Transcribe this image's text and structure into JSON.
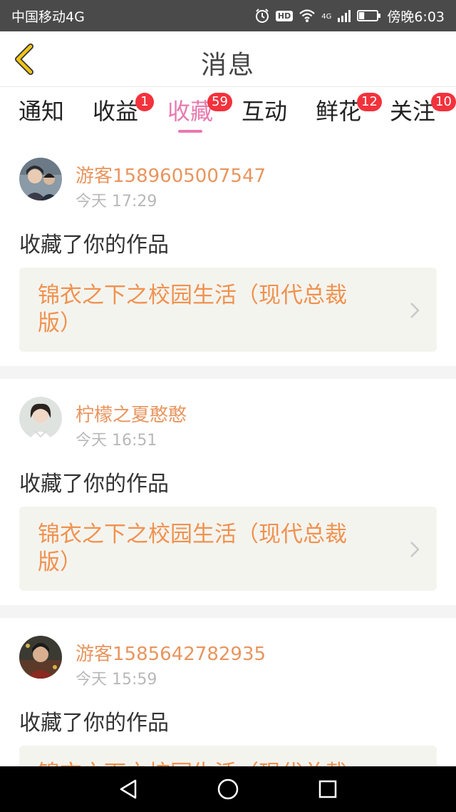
{
  "status_bar": {
    "carrier": "中国移动4G",
    "network_type": "4G",
    "time": "傍晚6:03",
    "icons": [
      "alarm-icon",
      "hd-icon",
      "wifi-icon",
      "signal-icon",
      "battery-icon"
    ],
    "hd_label": "HD",
    "battery_level": 0.3
  },
  "header": {
    "title": "消息",
    "back_icon": "chevron-left-icon"
  },
  "tabs": [
    {
      "label": "通知",
      "badge": "",
      "active": false
    },
    {
      "label": "收益",
      "badge": "1",
      "active": false
    },
    {
      "label": "收藏",
      "badge": "59",
      "active": true
    },
    {
      "label": "互动",
      "badge": "",
      "active": false
    },
    {
      "label": "鲜花",
      "badge": "12",
      "active": false
    },
    {
      "label": "关注",
      "badge": "10",
      "active": false
    }
  ],
  "feed": [
    {
      "username": "游客1589605007547",
      "time": "今天 17:29",
      "action": "收藏了你的作品",
      "work_title": "锦衣之下之校园生活（现代总裁版）"
    },
    {
      "username": "柠檬之夏憨憨",
      "time": "今天 16:51",
      "action": "收藏了你的作品",
      "work_title": "锦衣之下之校园生活（现代总裁版）"
    },
    {
      "username": "游客1585642782935",
      "time": "今天 15:59",
      "action": "收藏了你的作品",
      "work_title": "锦衣之下之校园生活（现代总裁版）"
    }
  ],
  "colors": {
    "accent": "#e879b0",
    "username": "#e8955e",
    "work_title": "#f0924f",
    "badge": "#f2323c",
    "back_icon": "#f2c417"
  },
  "nav_bar": {
    "icons": [
      "back-triangle-icon",
      "home-circle-icon",
      "recents-square-icon"
    ]
  }
}
